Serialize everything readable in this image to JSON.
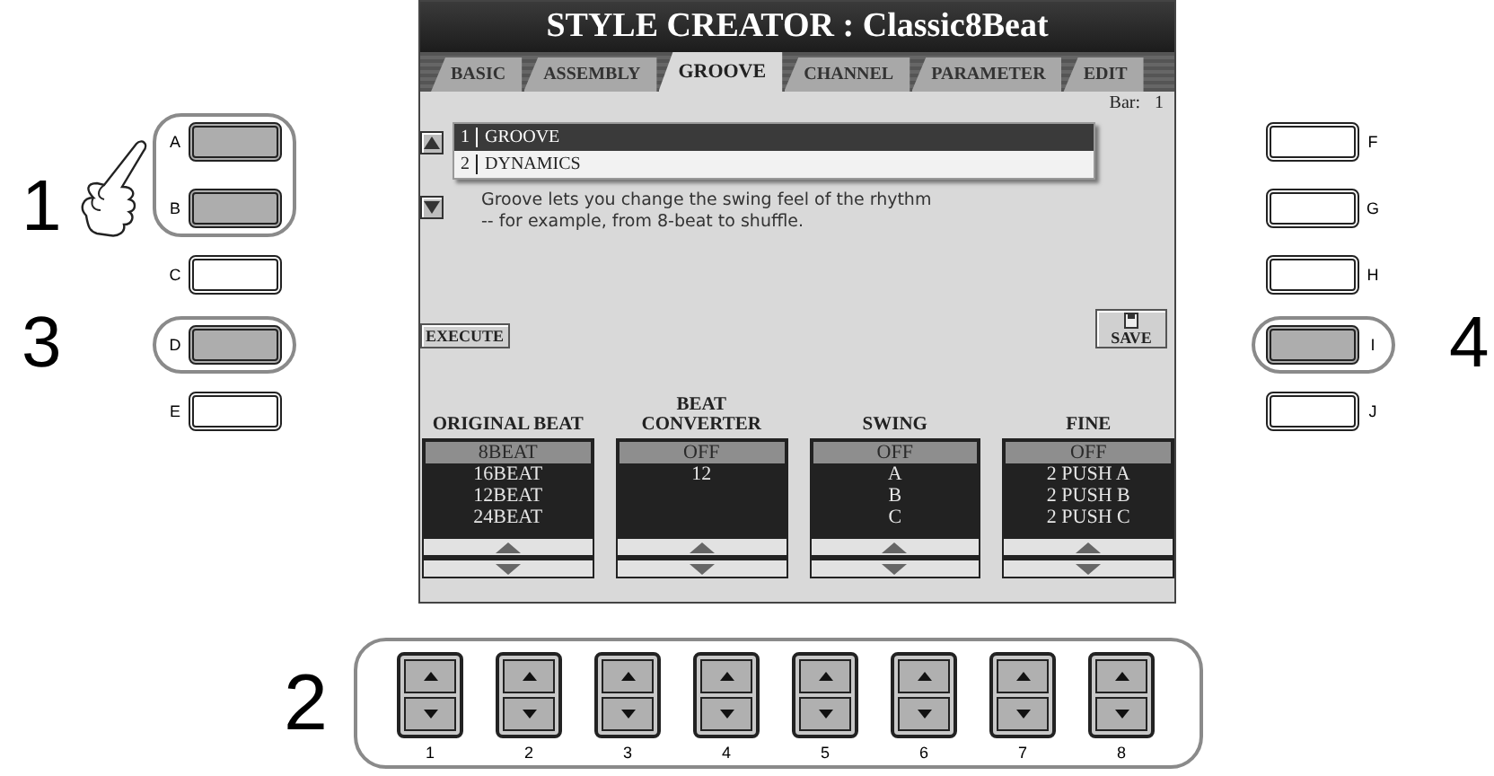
{
  "left_buttons": {
    "groups": [
      {
        "step": "1",
        "pointer": true,
        "circled": true,
        "buttons": [
          {
            "label": "A",
            "pressed": true
          },
          {
            "label": "B",
            "pressed": true
          }
        ]
      },
      {
        "pointer": false,
        "circled": false,
        "buttons": [
          {
            "label": "C",
            "pressed": false
          }
        ]
      },
      {
        "step": "3",
        "pointer": false,
        "circled": true,
        "buttons": [
          {
            "label": "D",
            "pressed": true
          }
        ]
      },
      {
        "pointer": false,
        "circled": false,
        "buttons": [
          {
            "label": "E",
            "pressed": false
          }
        ]
      }
    ]
  },
  "screen": {
    "title": "STYLE CREATOR : Classic8Beat",
    "tabs": [
      {
        "label": "BASIC",
        "selected": false
      },
      {
        "label": "ASSEMBLY",
        "selected": false
      },
      {
        "label": "GROOVE",
        "selected": true
      },
      {
        "label": "CHANNEL",
        "selected": false
      },
      {
        "label": "PARAMETER",
        "selected": false
      },
      {
        "label": "EDIT",
        "selected": false
      }
    ],
    "bar_label": "Bar:",
    "bar_value": "1",
    "list": [
      {
        "number": "1",
        "name": "GROOVE",
        "selected": true
      },
      {
        "number": "2",
        "name": "DYNAMICS",
        "selected": false
      }
    ],
    "description": "Groove lets you change the swing feel of the rhythm\n-- for example, from 8-beat to shuffle.",
    "execute_button": "EXECUTE",
    "save_button": "SAVE",
    "columns": [
      {
        "heading": "ORIGINAL BEAT",
        "values": [
          {
            "text": "8BEAT",
            "selected": true
          },
          {
            "text": "16BEAT",
            "selected": false
          },
          {
            "text": "12BEAT",
            "selected": false
          },
          {
            "text": "24BEAT",
            "selected": false
          }
        ]
      },
      {
        "heading": "BEAT\nCONVERTER",
        "values": [
          {
            "text": "OFF",
            "selected": true
          },
          {
            "text": "12",
            "selected": false
          }
        ]
      },
      {
        "heading": "SWING",
        "values": [
          {
            "text": "OFF",
            "selected": true
          },
          {
            "text": "A",
            "selected": false
          },
          {
            "text": "B",
            "selected": false
          },
          {
            "text": "C",
            "selected": false
          }
        ]
      },
      {
        "heading": "FINE",
        "values": [
          {
            "text": "OFF",
            "selected": true
          },
          {
            "text": "2 PUSH A",
            "selected": false
          },
          {
            "text": "2 PUSH B",
            "selected": false
          },
          {
            "text": "2 PUSH C",
            "selected": false
          }
        ]
      }
    ]
  },
  "right_buttons": {
    "groups": [
      {
        "pointer": false,
        "circled": false,
        "buttons": [
          {
            "label": "F",
            "pressed": false
          }
        ]
      },
      {
        "pointer": false,
        "circled": false,
        "buttons": [
          {
            "label": "G",
            "pressed": false
          }
        ]
      },
      {
        "pointer": false,
        "circled": false,
        "buttons": [
          {
            "label": "H",
            "pressed": false
          }
        ]
      },
      {
        "step": "4",
        "pointer": false,
        "circled": true,
        "buttons": [
          {
            "label": "I",
            "pressed": true
          }
        ]
      },
      {
        "pointer": false,
        "circled": false,
        "buttons": [
          {
            "label": "J",
            "pressed": false
          }
        ]
      }
    ]
  },
  "bottom_buttons": {
    "step": "2",
    "circled": true,
    "buttons": [
      "1",
      "2",
      "3",
      "4",
      "5",
      "6",
      "7",
      "8"
    ]
  }
}
